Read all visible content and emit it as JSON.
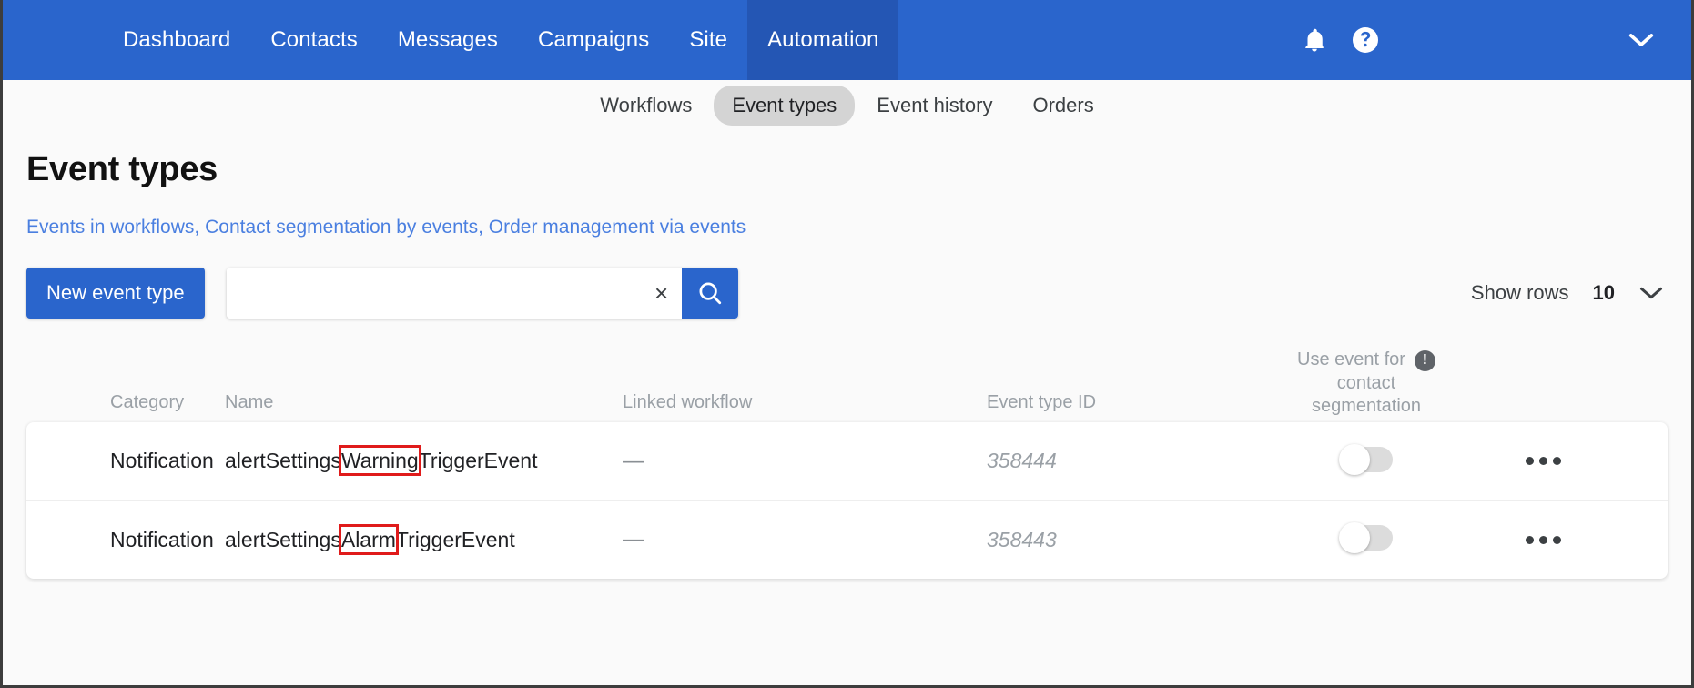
{
  "theme": {
    "brand_blue": "#2a65cc",
    "brand_blue_active": "#2456b4",
    "link_blue": "#4a7fe0",
    "highlight_red": "#e01b1b",
    "muted_gray": "#9aa0a6"
  },
  "topnav": {
    "items": [
      {
        "label": "Dashboard",
        "active": false
      },
      {
        "label": "Contacts",
        "active": false
      },
      {
        "label": "Messages",
        "active": false
      },
      {
        "label": "Campaigns",
        "active": false
      },
      {
        "label": "Site",
        "active": false
      },
      {
        "label": "Automation",
        "active": true
      }
    ],
    "icons": {
      "notifications": "bell-icon",
      "help": "help-circle-icon",
      "account_menu": "chevron-down-icon"
    }
  },
  "subnav": {
    "items": [
      {
        "label": "Workflows",
        "active": false
      },
      {
        "label": "Event types",
        "active": true
      },
      {
        "label": "Event history",
        "active": false
      },
      {
        "label": "Orders",
        "active": false
      }
    ]
  },
  "main": {
    "title": "Event types",
    "links": [
      "Events in workflows",
      "Contact segmentation by events",
      "Order management via events"
    ],
    "link_separator": ", "
  },
  "toolbar": {
    "new_button_label": "New event type",
    "search": {
      "value": "",
      "placeholder": "",
      "clear_label": "×",
      "search_icon": "magnifier-icon"
    },
    "show_rows": {
      "label": "Show rows",
      "value": "10",
      "caret_icon": "chevron-down-icon"
    }
  },
  "table": {
    "columns": [
      "Category",
      "Name",
      "Linked workflow",
      "Event type ID",
      "Use event for contact segmentation",
      ""
    ],
    "segmentation_header": {
      "line1": "Use event for",
      "line2": "contact",
      "line3": "segmentation",
      "info_icon": "info-exclamation-icon",
      "info_glyph": "!"
    },
    "rows": [
      {
        "category": "Notification",
        "name_prefix": "alertSettings",
        "name_highlight": "Warning",
        "name_suffix": "TriggerEvent",
        "linked_workflow": "—",
        "event_type_id": "358444",
        "segmentation_enabled": false,
        "actions_icon": "ellipsis-icon"
      },
      {
        "category": "Notification",
        "name_prefix": "alertSettings",
        "name_highlight": "Alarm",
        "name_suffix": "TriggerEvent",
        "linked_workflow": "—",
        "event_type_id": "358443",
        "segmentation_enabled": false,
        "actions_icon": "ellipsis-icon"
      }
    ]
  }
}
